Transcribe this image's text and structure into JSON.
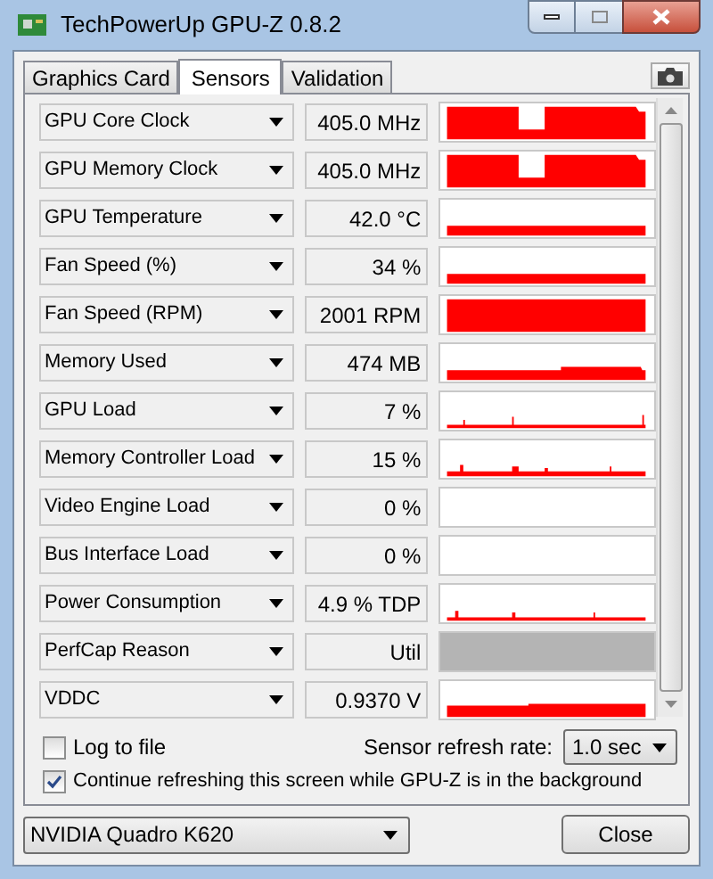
{
  "window": {
    "title": "TechPowerUp GPU-Z 0.8.2"
  },
  "tabs": [
    {
      "label": "Graphics Card",
      "selected": false
    },
    {
      "label": "Sensors",
      "selected": true
    },
    {
      "label": "Validation",
      "selected": false
    }
  ],
  "sensors": [
    {
      "name": "GPU Core Clock",
      "reading": "405.0 MHz",
      "kind": "graph"
    },
    {
      "name": "GPU Memory Clock",
      "reading": "405.0 MHz",
      "kind": "graph"
    },
    {
      "name": "GPU Temperature",
      "reading": "42.0 °C",
      "kind": "graph"
    },
    {
      "name": "Fan Speed (%)",
      "reading": "34 %",
      "kind": "graph"
    },
    {
      "name": "Fan Speed (RPM)",
      "reading": "2001 RPM",
      "kind": "graph"
    },
    {
      "name": "Memory Used",
      "reading": "474 MB",
      "kind": "graph"
    },
    {
      "name": "GPU Load",
      "reading": "7 %",
      "kind": "graph"
    },
    {
      "name": "Memory Controller Load",
      "reading": "15 %",
      "kind": "graph"
    },
    {
      "name": "Video Engine Load",
      "reading": "0 %",
      "kind": "graph"
    },
    {
      "name": "Bus Interface Load",
      "reading": "0 %",
      "kind": "graph"
    },
    {
      "name": "Power Consumption",
      "reading": "4.9 % TDP",
      "kind": "graph"
    },
    {
      "name": "PerfCap Reason",
      "reading": "Util",
      "kind": "status"
    },
    {
      "name": "VDDC",
      "reading": "0.9370 V",
      "kind": "graph"
    }
  ],
  "log_to_file": {
    "label": "Log to file",
    "checked": false
  },
  "refresh_rate": {
    "label": "Sensor refresh rate:",
    "value": "1.0 sec"
  },
  "continue_refreshing": {
    "label": "Continue refreshing this screen while GPU-Z is in the background",
    "checked": true
  },
  "gpu_select": {
    "value": "NVIDIA Quadro K620"
  },
  "close_button": {
    "label": "Close"
  }
}
